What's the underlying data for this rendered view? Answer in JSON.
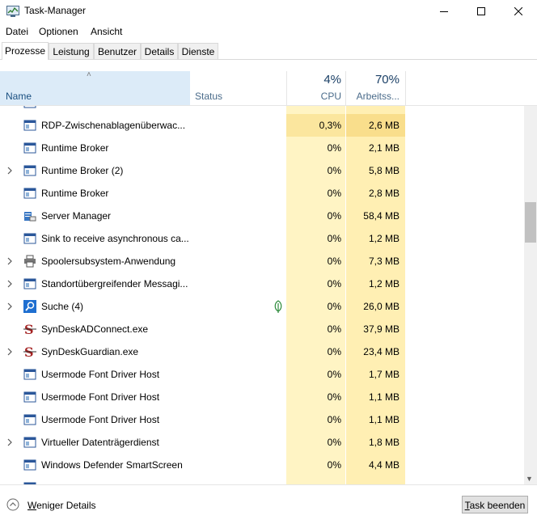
{
  "window": {
    "title": "Task-Manager",
    "icon": "task-manager-icon",
    "controls": [
      "minimize-icon",
      "maximize-icon",
      "close-icon"
    ]
  },
  "menu": [
    {
      "label": "Datei"
    },
    {
      "label": "Optionen"
    },
    {
      "label": "Ansicht"
    }
  ],
  "tabs": [
    {
      "label": "Prozesse",
      "active": true
    },
    {
      "label": "Leistung"
    },
    {
      "label": "Benutzer"
    },
    {
      "label": "Details"
    },
    {
      "label": "Dienste"
    }
  ],
  "columns": {
    "name": "Name",
    "status": "Status",
    "cpu_pct": "4%",
    "cpu": "CPU",
    "mem_pct": "70%",
    "mem": "Arbeitss..."
  },
  "rows": [
    {
      "name": "RDP-Zwischenablagenüberwac...",
      "cpu": "0,3%",
      "mem": "2,6 MB",
      "expandable": false,
      "icon": "app-window-icon",
      "highlight": true
    },
    {
      "name": "Runtime Broker",
      "cpu": "0%",
      "mem": "2,1 MB",
      "expandable": false,
      "icon": "app-window-icon"
    },
    {
      "name": "Runtime Broker (2)",
      "cpu": "0%",
      "mem": "5,8 MB",
      "expandable": true,
      "icon": "app-window-icon"
    },
    {
      "name": "Runtime Broker",
      "cpu": "0%",
      "mem": "2,8 MB",
      "expandable": false,
      "icon": "app-window-icon"
    },
    {
      "name": "Server Manager",
      "cpu": "0%",
      "mem": "58,4 MB",
      "expandable": false,
      "icon": "server-manager-icon"
    },
    {
      "name": "Sink to receive asynchronous ca...",
      "cpu": "0%",
      "mem": "1,2 MB",
      "expandable": false,
      "icon": "app-window-icon"
    },
    {
      "name": "Spoolersubsystem-Anwendung",
      "cpu": "0%",
      "mem": "7,3 MB",
      "expandable": true,
      "icon": "printer-icon"
    },
    {
      "name": "Standortübergreifender Messagi...",
      "cpu": "0%",
      "mem": "1,2 MB",
      "expandable": true,
      "icon": "app-window-icon"
    },
    {
      "name": "Suche (4)",
      "cpu": "0%",
      "mem": "26,0 MB",
      "expandable": true,
      "icon": "search-icon",
      "status_icon": "leaf-icon"
    },
    {
      "name": "SynDeskADConnect.exe",
      "cpu": "0%",
      "mem": "37,9 MB",
      "expandable": false,
      "icon": "syndesk-icon"
    },
    {
      "name": "SynDeskGuardian.exe",
      "cpu": "0%",
      "mem": "23,4 MB",
      "expandable": true,
      "icon": "syndesk-icon"
    },
    {
      "name": "Usermode Font Driver Host",
      "cpu": "0%",
      "mem": "1,7 MB",
      "expandable": false,
      "icon": "app-window-icon"
    },
    {
      "name": "Usermode Font Driver Host",
      "cpu": "0%",
      "mem": "1,1 MB",
      "expandable": false,
      "icon": "app-window-icon"
    },
    {
      "name": "Usermode Font Driver Host",
      "cpu": "0%",
      "mem": "1,1 MB",
      "expandable": false,
      "icon": "app-window-icon"
    },
    {
      "name": "Virtueller Datenträgerdienst",
      "cpu": "0%",
      "mem": "1,8 MB",
      "expandable": true,
      "icon": "app-window-icon"
    },
    {
      "name": "Windows Defender SmartScreen",
      "cpu": "0%",
      "mem": "4,4 MB",
      "expandable": false,
      "icon": "app-window-icon"
    }
  ],
  "footer": {
    "less_details": "Weniger Details",
    "end_task": "Task beenden"
  }
}
